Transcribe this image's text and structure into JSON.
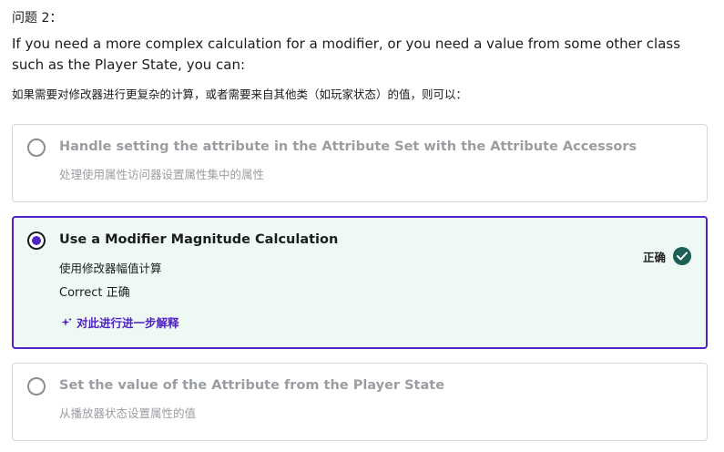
{
  "question": {
    "label": "问题 2：",
    "text_en": "If you need a more complex calculation for a modifier, or you need a value from some other class such as the Player State, you can:",
    "text_zh": "如果需要对修改器进行更复杂的计算，或者需要来自其他类（如玩家状态）的值，则可以："
  },
  "options": [
    {
      "title": "Handle setting the attribute in the Attribute Set with the Attribute Accessors",
      "subtitle": "处理使用属性访问器设置属性集中的属性",
      "selected": false
    },
    {
      "title": "Use a Modifier Magnitude Calculation",
      "subtitle": "使用修改器幅值计算",
      "selected": true,
      "feedback": "Correct  正确",
      "status_label": "正确",
      "explain_label": "对此进行进一步解释"
    },
    {
      "title": "Set the value of the Attribute from the Player State",
      "subtitle": "从播放器状态设置属性的值",
      "selected": false
    }
  ],
  "colors": {
    "accent": "#5022c3",
    "correct_bg": "#eef9f3",
    "check_green": "#1e6055",
    "muted_text": "#9a9ea2"
  }
}
